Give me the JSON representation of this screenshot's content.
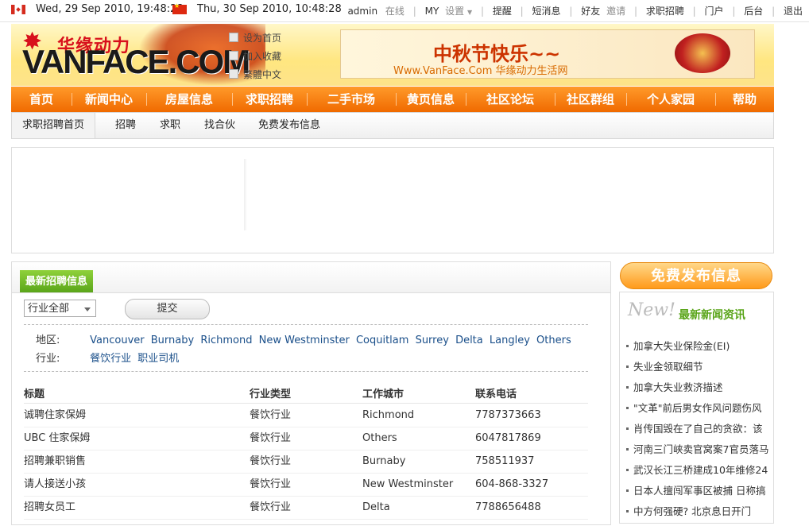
{
  "topbar": {
    "time_vancouver": "Wed, 29 Sep 2010, 19:48:28",
    "time_china": "Thu, 30 Sep 2010, 10:48:28",
    "user": "admin",
    "online": "在线",
    "my": "MY",
    "settings": "设置",
    "links": [
      "提醒",
      "短消息",
      "好友",
      "邀请",
      "求职招聘",
      "门户",
      "后台",
      "退出"
    ]
  },
  "header": {
    "logo_cn": "华缘动力",
    "logo_en": "VANFACE.COM",
    "links": [
      "设为首页",
      "加入收藏",
      "繁體中文"
    ],
    "banner_title": "中秋节快乐~~",
    "banner_sub": "Www.VanFace.Com 华缘动力生活网"
  },
  "nav": [
    "首页",
    "新闻中心",
    "房屋信息",
    "求职招聘",
    "二手市场",
    "黄页信息",
    "社区论坛",
    "社区群组",
    "个人家园",
    "帮助"
  ],
  "subnav": [
    "求职招聘首页",
    "招聘",
    "求职",
    "找合伙",
    "免费发布信息"
  ],
  "main": {
    "tab": "最新招聘信息",
    "select_value": "行业全部",
    "submit": "提交",
    "region_label": "地区:",
    "regions": [
      "Vancouver",
      "Burnaby",
      "Richmond",
      "New Westminster",
      "Coquitlam",
      "Surrey",
      "Delta",
      "Langley",
      "Others"
    ],
    "industry_label": "行业:",
    "industries": [
      "餐饮行业",
      "职业司机"
    ],
    "columns": [
      "标题",
      "行业类型",
      "工作城市",
      "联系电话"
    ],
    "rows": [
      [
        "诚聘住家保姆",
        "餐饮行业",
        "Richmond",
        "7787373663"
      ],
      [
        "UBC 住家保姆",
        "餐饮行业",
        "Others",
        "6047817869"
      ],
      [
        "招聘兼职销售",
        "餐饮行业",
        "Burnaby",
        "758511937"
      ],
      [
        "请人接送小孩",
        "餐饮行业",
        "New Westminster",
        "604-868-3327"
      ],
      [
        "招聘女员工",
        "餐饮行业",
        "Delta",
        "7788656488"
      ]
    ]
  },
  "sidebar": {
    "free_publish": "免费发布信息",
    "new_badge": "New!",
    "news_title": "最新新闻资讯",
    "news": [
      "加拿大失业保险金(EI)",
      "失业金领取细节",
      "加拿大失业救济描述",
      "\"文革\"前后男女作风问题伤风",
      "肖传国毁在了自己的贪欲：该",
      "河南三门峡卖官窝案7官员落马",
      "武汉长江三桥建成10年维修24",
      "日本人擅闯军事区被捕 日称搞",
      "中方何强硬? 北京息日开门"
    ]
  }
}
